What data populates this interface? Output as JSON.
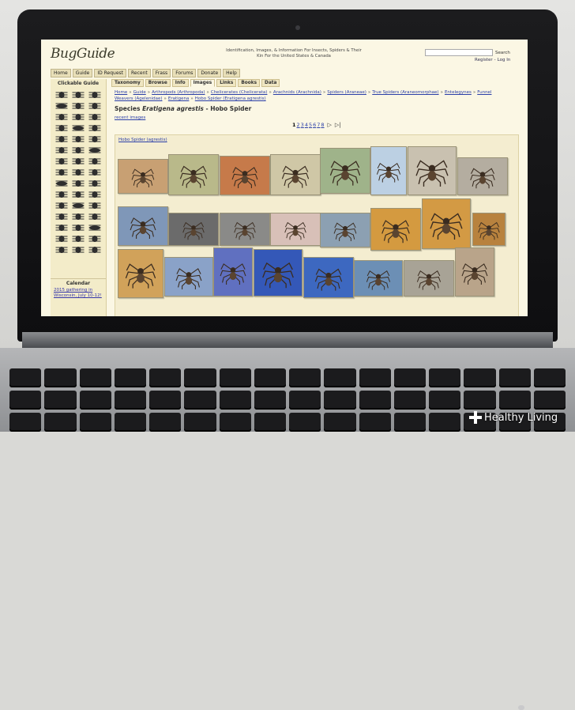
{
  "site": {
    "logo": "BugGuide",
    "tagline": "Identification, Images, & Information For Insects, Spiders & Their Kin For the United States & Canada",
    "search_button": "Search",
    "register": "Register",
    "sep": "-",
    "login": "Log In"
  },
  "top_nav": [
    "Home",
    "Guide",
    "ID Request",
    "Recent",
    "Frass",
    "Forums",
    "Donate",
    "Help"
  ],
  "sub_nav": {
    "tabs": [
      "Taxonomy",
      "Browse",
      "Info",
      "Images",
      "Links",
      "Books",
      "Data"
    ],
    "active": "Images"
  },
  "sidebar": {
    "title": "Clickable Guide",
    "calendar_title": "Calendar",
    "calendar_link": "2015 gathering in Wisconsin, July 10-12!"
  },
  "breadcrumb": [
    "Home",
    "Guide",
    "Arthropods (Arthropoda)",
    "Chelicerates (Chelicerata)",
    "Arachnids (Arachnida)",
    "Spiders (Araneae)",
    "True Spiders (Araneomorphae)",
    "Entelegynes",
    "Funnel Weavers (Agelenidae)",
    "Eratigena",
    "Hobo Spider (Eratigena agrestis)"
  ],
  "heading": {
    "prefix": "Species",
    "scientific": "Eratigena agrestis",
    "sep": "-",
    "common": "Hobo Spider"
  },
  "recent_link": "recent images",
  "pagination": {
    "pages": [
      "1",
      "2",
      "3",
      "4",
      "5",
      "6",
      "7",
      "8"
    ],
    "current": "1"
  },
  "gallery": {
    "label": "Hobo Spider (agrestis)",
    "thumbnails": [
      {
        "bg": "#c8a073"
      },
      {
        "bg": "#b9b98a"
      },
      {
        "bg": "#c67a4a"
      },
      {
        "bg": "#cfc7a6"
      },
      {
        "bg": "#9fb38a"
      },
      {
        "bg": "#bcd0e3"
      },
      {
        "bg": "#c9c1b0"
      },
      {
        "bg": "#b4ada0"
      },
      {
        "bg": "#7f97b8"
      },
      {
        "bg": "#6b6b6b"
      },
      {
        "bg": "#8a8a88"
      },
      {
        "bg": "#d8c0b8"
      },
      {
        "bg": "#8ca0b2"
      },
      {
        "bg": "#d49a40"
      },
      {
        "bg": "#d39a44"
      },
      {
        "bg": "#b8823e"
      },
      {
        "bg": "#d1a25a"
      },
      {
        "bg": "#8aa2c8"
      },
      {
        "bg": "#6070c0"
      },
      {
        "bg": "#3458b8"
      },
      {
        "bg": "#3d68c0"
      },
      {
        "bg": "#6c8fb5"
      },
      {
        "bg": "#a8a396"
      },
      {
        "bg": "#b9a48a"
      }
    ]
  },
  "brand": {
    "text": "Healthy Living"
  },
  "colors": {
    "page_bg": "#fbf7e4",
    "link": "#2b3fa8",
    "nav_bg": "#e8dfb8"
  }
}
